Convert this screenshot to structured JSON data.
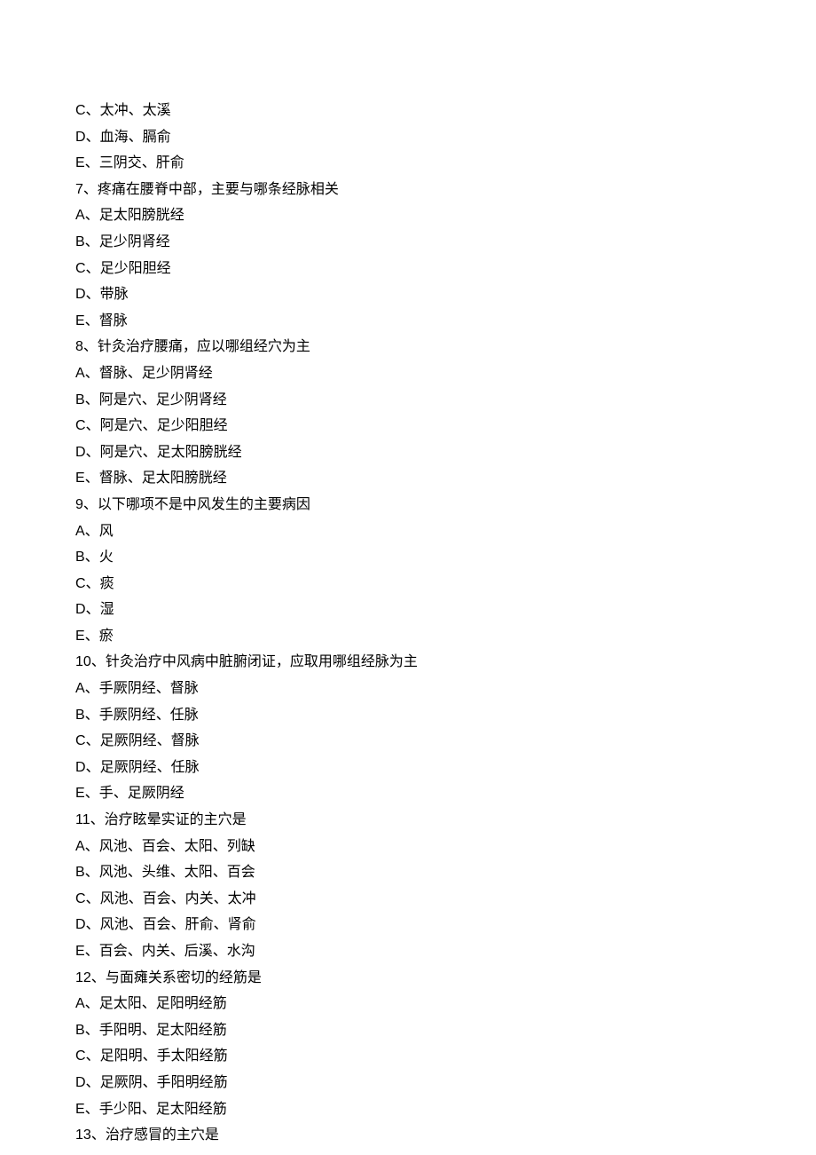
{
  "lines": [
    {
      "label": "C、",
      "text": "太冲、太溪"
    },
    {
      "label": "D、",
      "text": "血海、膈俞"
    },
    {
      "label": "E、",
      "text": "三阴交、肝俞"
    },
    {
      "label": "7、",
      "text": "疼痛在腰脊中部，主要与哪条经脉相关"
    },
    {
      "label": "A、",
      "text": "足太阳膀胱经"
    },
    {
      "label": "B、",
      "text": "足少阴肾经"
    },
    {
      "label": "C、",
      "text": "足少阳胆经"
    },
    {
      "label": "D、",
      "text": "带脉"
    },
    {
      "label": "E、",
      "text": "督脉"
    },
    {
      "label": "8、",
      "text": "针灸治疗腰痛，应以哪组经穴为主"
    },
    {
      "label": "A、",
      "text": "督脉、足少阴肾经"
    },
    {
      "label": "B、",
      "text": "阿是穴、足少阴肾经"
    },
    {
      "label": "C、",
      "text": "阿是穴、足少阳胆经"
    },
    {
      "label": "D、",
      "text": "阿是穴、足太阳膀胱经"
    },
    {
      "label": "E、",
      "text": "督脉、足太阳膀胱经"
    },
    {
      "label": "9、",
      "text": "以下哪项不是中风发生的主要病因"
    },
    {
      "label": "A、",
      "text": "风"
    },
    {
      "label": "B、",
      "text": "火"
    },
    {
      "label": "C、",
      "text": "痰"
    },
    {
      "label": "D、",
      "text": "湿"
    },
    {
      "label": "E、",
      "text": "瘀"
    },
    {
      "label": "10、",
      "text": "针灸治疗中风病中脏腑闭证，应取用哪组经脉为主"
    },
    {
      "label": "A、",
      "text": "手厥阴经、督脉"
    },
    {
      "label": "B、",
      "text": "手厥阴经、任脉"
    },
    {
      "label": "C、",
      "text": "足厥阴经、督脉"
    },
    {
      "label": "D、",
      "text": "足厥阴经、任脉"
    },
    {
      "label": "E、",
      "text": "手、足厥阴经"
    },
    {
      "label": "11、",
      "text": "治疗眩晕实证的主穴是"
    },
    {
      "label": "A、",
      "text": "风池、百会、太阳、列缺"
    },
    {
      "label": "B、",
      "text": "风池、头维、太阳、百会"
    },
    {
      "label": "C、",
      "text": "风池、百会、内关、太冲"
    },
    {
      "label": "D、",
      "text": "风池、百会、肝俞、肾俞"
    },
    {
      "label": "E、",
      "text": "百会、内关、后溪、水沟"
    },
    {
      "label": "12、",
      "text": "与面瘫关系密切的经筋是"
    },
    {
      "label": "A、",
      "text": "足太阳、足阳明经筋"
    },
    {
      "label": "B、",
      "text": "手阳明、足太阳经筋"
    },
    {
      "label": "C、",
      "text": "足阳明、手太阳经筋"
    },
    {
      "label": "D、",
      "text": "足厥阴、手阳明经筋"
    },
    {
      "label": "E、",
      "text": "手少阳、足太阳经筋"
    },
    {
      "label": "13、",
      "text": "治疗感冒的主穴是"
    }
  ]
}
